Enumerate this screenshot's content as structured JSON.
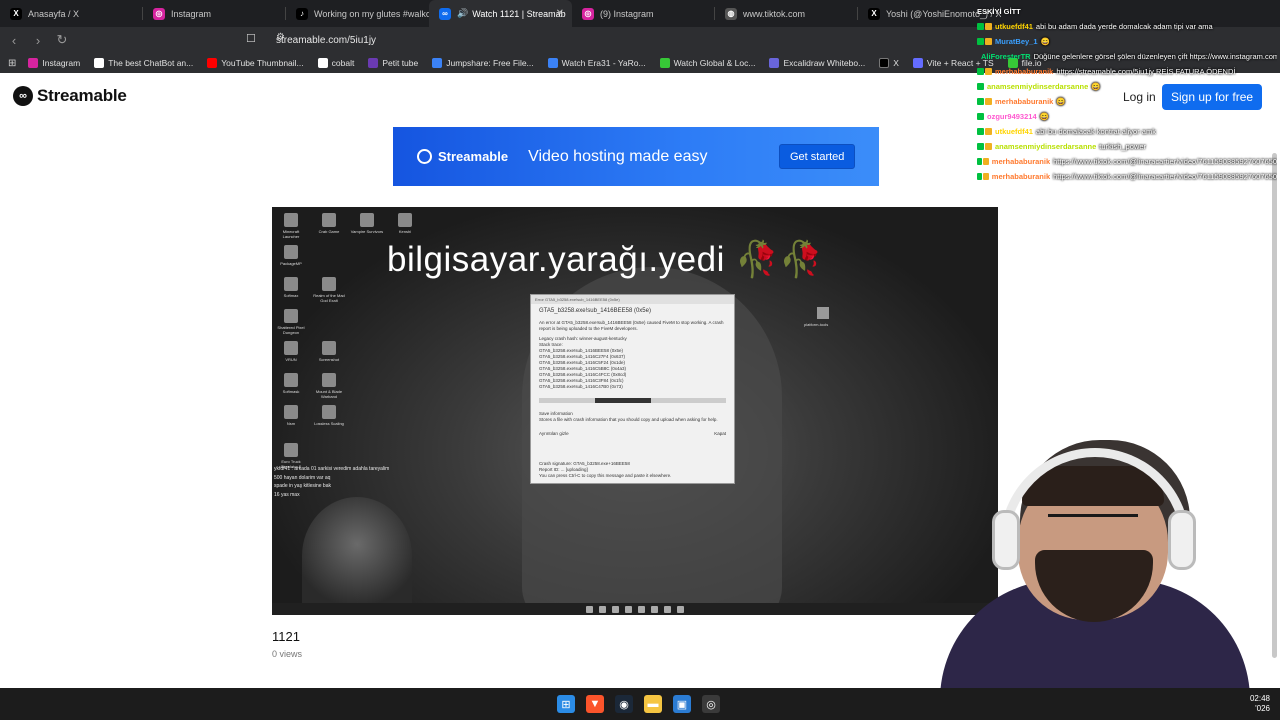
{
  "tabs": [
    {
      "title": "Anasayfa / X",
      "icon": "x-logo-icon",
      "color": "#000000"
    },
    {
      "title": "Instagram",
      "icon": "instagram-icon",
      "color": "#d6249f"
    },
    {
      "title": "Working on my glutes #walko",
      "icon": "tiktok-icon",
      "color": "#000000"
    },
    {
      "title": "Watch 1121 | Streamab",
      "icon": "streamable-icon",
      "color": "#0f6cef"
    },
    {
      "title": "(9) Instagram",
      "icon": "instagram-icon",
      "color": "#d6249f"
    },
    {
      "title": "www.tiktok.com",
      "icon": "globe-icon",
      "color": "#666666"
    },
    {
      "title": "Yoshi (@YoshiEnomoto_) / X",
      "icon": "x-logo-icon",
      "color": "#000000"
    }
  ],
  "address": {
    "url": "streamable.com/5iu1jy"
  },
  "bookmarks": [
    {
      "label": "Instagram",
      "color": "#d6249f"
    },
    {
      "label": "The best ChatBot an...",
      "color": "#ffffff"
    },
    {
      "label": "YouTube Thumbnail...",
      "color": "#ff0000"
    },
    {
      "label": "cobalt",
      "color": "#ffffff"
    },
    {
      "label": "Petit tube",
      "color": "#6a3ab2"
    },
    {
      "label": "Jumpshare: Free File...",
      "color": "#3b82f6"
    },
    {
      "label": "Watch Era31 - YaRo...",
      "color": "#3b82f6"
    },
    {
      "label": "Watch Global & Loc...",
      "color": "#37c837"
    },
    {
      "label": "Excalidraw Whitebo...",
      "color": "#6965db"
    },
    {
      "label": "X",
      "color": "#000000"
    },
    {
      "label": "Vite + React + TS",
      "color": "#646cff"
    },
    {
      "label": "file.io",
      "color": "#37c837"
    }
  ],
  "site": {
    "logo_text": "Streamable",
    "login": "Log in",
    "signup": "Sign up for free"
  },
  "banner": {
    "brand": "Streamable",
    "tagline": "Video hosting made easy",
    "cta": "Get started"
  },
  "video": {
    "overlay_text": "bilgisayar.yarağı.yedi",
    "overlay_emoji": "🥀🥀",
    "title": "1121",
    "views": "0 views",
    "error_dialog": {
      "header": "Error GTA5_b3258.exe!sub_1416BEE58 (0x5e)",
      "title": "GTA5_b3258.exe!sub_1416BEE58 (0x5e)",
      "body": "An error at GTA5_b3258.exe!sub_1416BEE58 (0x5e) caused FiveM to stop working. A crash report is being uploaded to the FiveM developers.",
      "legacy": "Legacy crash hash: winner-august-kentucky",
      "stack_label": "Stack trace:",
      "stack": [
        "GTA5_b3258.exe!sub_1416BEE58 (0x5e)",
        "GTA5_b3258.exe!sub_1416C27F4 (0x637)",
        "GTA5_b3258.exe!sub_1416C5F24 (0x1de)",
        "GTA5_b3258.exe!sub_1416C5B8C (0x4a3)",
        "GTA5_b3258.exe!sub_1416C4FCC (0x8cd)",
        "GTA5_b3258.exe!sub_1416C3F84 (0x1fc)",
        "GTA5_b3258.exe!sub_1416C47B0 (0x73)"
      ],
      "save": "Save information",
      "save_desc": "Stores a file with crash information that you should copy and upload when asking for help.",
      "details": "Ayrıntıları gizle",
      "close": "Kapat",
      "signature": "Crash signature: GTA5_b3258.exe+16BEE58",
      "report": "Report ID: ... [uploading]",
      "copy_hint": "You can press Ctrl-C to copy this message and paste it elsewhere."
    },
    "mini_chat": [
      "ykfdf41 : arkada 01 sarkisi veredim adahla tareyalim",
      "500 hayan dolarim var aq",
      "spade in yaş kitlesine bak",
      "16 yas max"
    ],
    "desktop_icons": [
      "Minecraft Launcher",
      "Crab Game",
      "Vampire Survivors",
      "Kenshi",
      "PackageMP",
      "Softmax",
      "Realm of the Mad God Exalt",
      "Shattered Pixel Dungeon",
      "VRUN",
      "Screenshot",
      "Softmask",
      "Mount & Blade Warband",
      "Nsm",
      "Lossless Scaling",
      "Euro Truck Simulator 2"
    ],
    "platform_label": "platform-tools"
  },
  "stream_chat": {
    "top_label": "ESKİYİ GİTT",
    "lines": [
      {
        "user": "utkuefdf41",
        "user_color": "#ffd400",
        "msg": "abi bu adam dada yerde domalcak adam tipi var ama"
      },
      {
        "user": "MuratBey_1",
        "user_color": "#3aa0ff",
        "msg": "😄"
      },
      {
        "user": "AliForesterTR",
        "user_color": "#00e070",
        "msg": "Düğüne gelenlere görsel şölen düzenleyen çift https://www.instagram.com/reel/DVSItb7CIUo/?igsh=MTN3ejFwcXg2NGpjdA=="
      },
      {
        "user": "merhababuranik",
        "user_color": "#ff7a2f",
        "msg": "https://streamable.com/5iu1jy REİS FATURA ÖDENDİ"
      },
      {
        "user": "anamsenmiydinserdarsanne",
        "user_color": "#b8e000",
        "msg": "😄"
      },
      {
        "user": "merhababuranik",
        "user_color": "#ff7a2f",
        "msg": "😄"
      },
      {
        "user": "ozgur9493214",
        "user_color": "#ff5ad0",
        "msg": "😄"
      },
      {
        "user": "utkuefdf41",
        "user_color": "#ffd400",
        "msg": "abi bu domalacak kontrat aliyor amk"
      },
      {
        "user": "anamsenmiydinserdarsanne",
        "user_color": "#b8e000",
        "msg": "turkish_power"
      },
      {
        "user": "merhababuranik",
        "user_color": "#ff7a2f",
        "msg": "https://www.tiktok.com/@linaracartier/video/7611590385927607650"
      },
      {
        "user": "merhababuranik",
        "user_color": "#ff7a2f",
        "msg": "https://www.tiktok.com/@linaracartier/video/7611590385927607650"
      }
    ]
  },
  "taskbar": {
    "icons": [
      "windows-start-icon",
      "brave-icon",
      "steam-icon",
      "file-explorer-icon",
      "store-icon",
      "chrome-icon"
    ],
    "time": "02:48",
    "date": "'026"
  }
}
